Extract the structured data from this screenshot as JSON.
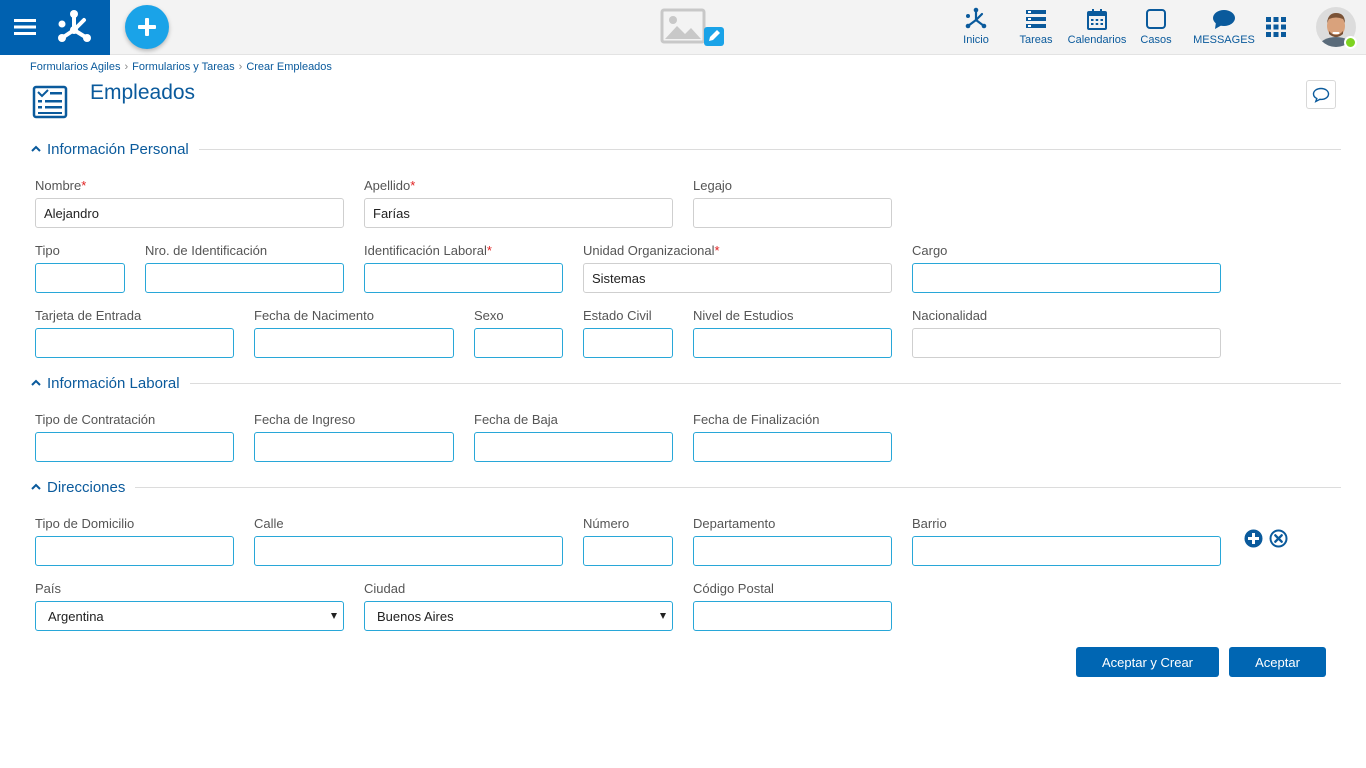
{
  "nav": {
    "items": [
      {
        "label": "Inicio",
        "icon": "network-icon"
      },
      {
        "label": "Tareas",
        "icon": "tasks-icon"
      },
      {
        "label": "Calendarios",
        "icon": "calendar-icon"
      },
      {
        "label": "Casos",
        "icon": "cases-icon"
      },
      {
        "label": "MESSAGES",
        "icon": "chat-icon"
      }
    ]
  },
  "breadcrumb": [
    "Formularios Agiles",
    "Formularios y Tareas",
    "Crear Empleados"
  ],
  "page": {
    "title": "Empleados"
  },
  "sections": {
    "personal": "Información Personal",
    "laboral": "Información Laboral",
    "direcciones": "Direcciones"
  },
  "fields": {
    "nombre": {
      "label": "Nombre",
      "value": "Alejandro",
      "required": "*"
    },
    "apellido": {
      "label": "Apellido",
      "value": "Farías",
      "required": "*"
    },
    "legajo": {
      "label": "Legajo",
      "value": ""
    },
    "tipo": {
      "label": "Tipo",
      "value": ""
    },
    "nro_identificacion": {
      "label": "Nro. de Identificación",
      "value": ""
    },
    "identificacion_laboral": {
      "label": "Identificación Laboral",
      "value": "",
      "required": "*"
    },
    "unidad_organizacional": {
      "label": "Unidad Organizacional",
      "value": "Sistemas",
      "required": "*"
    },
    "cargo": {
      "label": "Cargo",
      "value": ""
    },
    "tarjeta_entrada": {
      "label": "Tarjeta de Entrada",
      "value": ""
    },
    "fecha_nacimiento": {
      "label": "Fecha de Nacimento",
      "value": ""
    },
    "sexo": {
      "label": "Sexo",
      "value": ""
    },
    "estado_civil": {
      "label": "Estado Civil",
      "value": ""
    },
    "nivel_estudios": {
      "label": "Nivel de Estudios",
      "value": ""
    },
    "nacionalidad": {
      "label": "Nacionalidad",
      "value": ""
    },
    "tipo_contratacion": {
      "label": "Tipo de Contratación",
      "value": ""
    },
    "fecha_ingreso": {
      "label": "Fecha de Ingreso",
      "value": ""
    },
    "fecha_baja": {
      "label": "Fecha de Baja",
      "value": ""
    },
    "fecha_finalizacion": {
      "label": "Fecha de Finalización",
      "value": ""
    },
    "tipo_domicilio": {
      "label": "Tipo de Domicilio",
      "value": ""
    },
    "calle": {
      "label": "Calle",
      "value": ""
    },
    "numero": {
      "label": "Número",
      "value": ""
    },
    "departamento": {
      "label": "Departamento",
      "value": ""
    },
    "barrio": {
      "label": "Barrio",
      "value": ""
    },
    "pais": {
      "label": "País",
      "value": "Argentina"
    },
    "ciudad": {
      "label": "Ciudad",
      "value": "Buenos Aires"
    },
    "codigo_postal": {
      "label": "Código Postal",
      "value": ""
    }
  },
  "buttons": {
    "accept_create": "Aceptar y Crear",
    "accept": "Aceptar"
  },
  "colors": {
    "brand": "#0061b0",
    "accent": "#1aa3e8",
    "field_border": "#28a7d8",
    "status_online": "#7ed321"
  }
}
